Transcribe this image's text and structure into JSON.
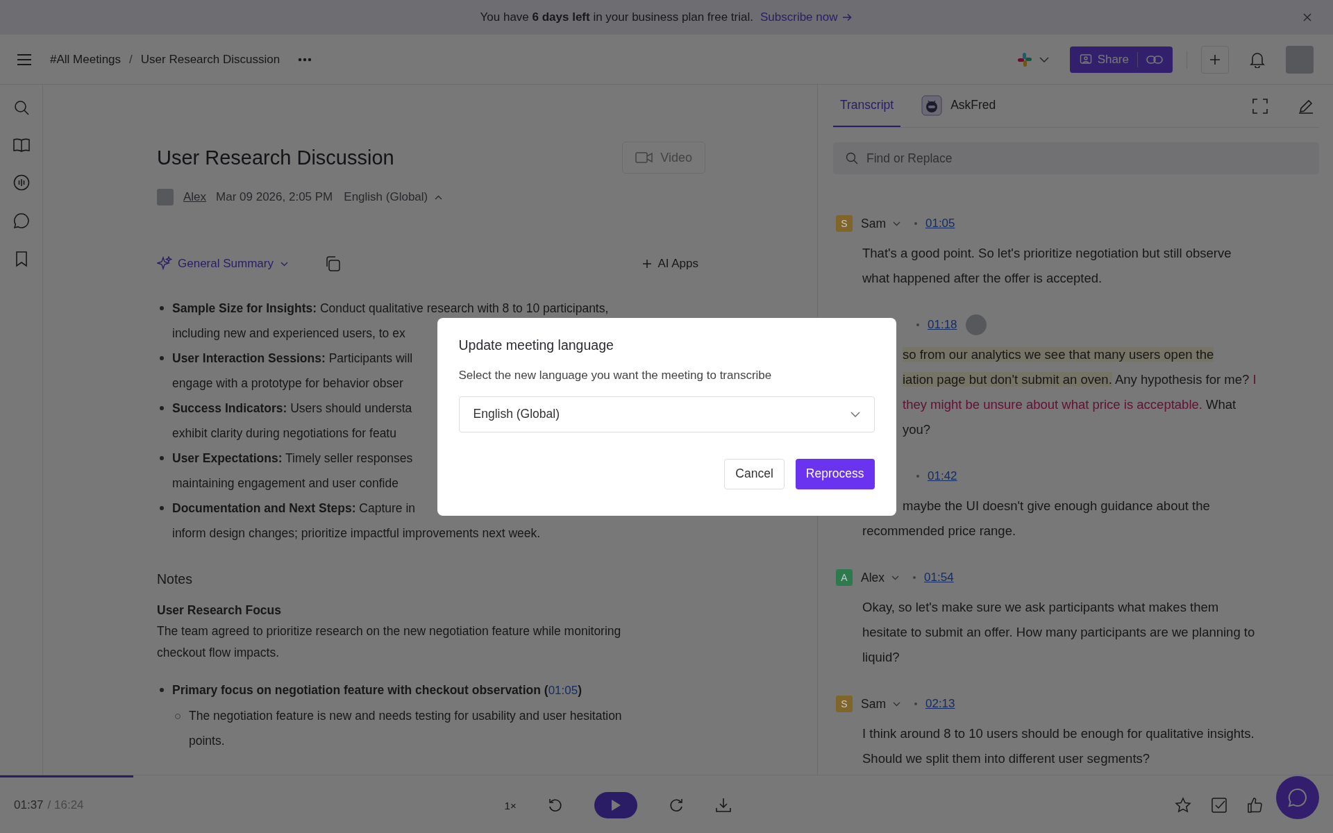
{
  "banner": {
    "message": "You have **6 days left** in your business plan free trial.",
    "link": "Subscribe now"
  },
  "header": {
    "breadcrumbs": [
      "#All Meetings",
      "User Research Discussion"
    ],
    "separator": "/",
    "share_label": "Share"
  },
  "meeting": {
    "title": "User Research Discussion",
    "video": {
      "label": "Video",
      "disabled": true
    },
    "author": "Alex",
    "date": "Mar 09 2026, 2:05 PM",
    "language": "English (Global)"
  },
  "summary_menu": "General Summary",
  "ai_apps": "AI Apps",
  "summary": [
    {
      "lines": [
        "**Sample Size for Insights:** Conduct qualitative research with 8 to 10 participants,",
        "including new and experienced users, to ex"
      ]
    },
    {
      "lines": [
        "**User Interaction Sessions:** Participants will",
        "engage with a prototype for behavior obser"
      ]
    },
    {
      "lines": [
        "**Success Indicators:** Users should understa",
        "exhibit clarity during negotiations for featu"
      ]
    },
    {
      "lines": [
        "**User Expectations:** Timely seller responses",
        "maintaining engagement and user confide"
      ]
    },
    {
      "lines": [
        "**Documentation and Next Steps:** Capture in",
        "inform design changes; prioritize impactful improvements next week."
      ]
    }
  ],
  "notes": {
    "heading": "Notes",
    "subheading": "User Research Focus",
    "paragraph": "The team agreed to prioritize research on the new negotiation feature while monitoring checkout flow impacts.",
    "items": [
      {
        "text": "Primary focus on negotiation feature with checkout observation",
        "open": "(",
        "timestamp": "01:05",
        "close": ")",
        "children": [
          {
            "text": "The negotiation feature is new and needs testing for usability and user hesitation points."
          }
        ]
      }
    ]
  },
  "dialog": {
    "title": "Update meeting language",
    "description": "Select the new language you want the meeting to transcribe",
    "select_value": "English (Global)",
    "buttons": [
      {
        "label": "Cancel",
        "kind": "secondary"
      },
      {
        "label": "Reprocess",
        "kind": "primary"
      }
    ]
  },
  "transcript": {
    "tabs": [
      {
        "label": "Transcript",
        "selected": true
      },
      {
        "label": "AskFred",
        "selected": false
      }
    ],
    "search": {
      "placeholder": "Find or Replace"
    },
    "entries": [
      {
        "speaker": "Sam",
        "initial": "S",
        "color": "#80652a",
        "time": "01:05",
        "text": [
          "That's a good point. So let's prioritize negotiation but still observe",
          "what happened after the offer is accepted."
        ]
      },
      {
        "time": "01:18",
        "viewer_avatar": true,
        "partly_hidden_lines": [
          {
            "segments": [
              {
                "text": "so from our analytics we see that many users open the",
                "kind": "playing"
              }
            ]
          },
          {
            "segments": [
              {
                "text": "iation page but don't submit an oven.",
                "kind": "playing"
              },
              {
                "text": " Any hypothesis for me?",
                "kind": "plain"
              },
              {
                "text": " I",
                "kind": "highlight"
              }
            ]
          },
          {
            "segments": [
              {
                "text": "they might be unsure about what price is acceptable.",
                "kind": "highlight"
              },
              {
                "text": " What",
                "kind": "plain"
              }
            ]
          },
          {
            "segments": [
              {
                "text": "you?",
                "kind": "plain"
              }
            ]
          }
        ]
      },
      {
        "time": "01:42",
        "partly_hidden_lines": [
          {
            "segments": [
              {
                "text": "maybe the UI doesn't give enough guidance about the",
                "kind": "plain"
              }
            ]
          }
        ],
        "lines": [
          {
            "segments": [
              {
                "text": "recommended price range.",
                "kind": "plain"
              }
            ]
          }
        ]
      },
      {
        "speaker": "Alex",
        "initial": "A",
        "color": "#2e7a4e",
        "time": "01:54",
        "text": [
          "Okay, so let's make sure we ask participants what makes them",
          "hesitate to submit an offer. How many participants are we planning to",
          "liquid?"
        ]
      },
      {
        "speaker": "Sam",
        "initial": "S",
        "color": "#80652a",
        "time": "02:13",
        "text": [
          "I think around 8 to 10 users should be enough for qualitative insights.",
          "Should we split them into different user segments?"
        ]
      }
    ]
  },
  "player": {
    "elapsed": "01:37",
    "total": "/ 16:24",
    "speed": "1×",
    "level": 0.1
  }
}
